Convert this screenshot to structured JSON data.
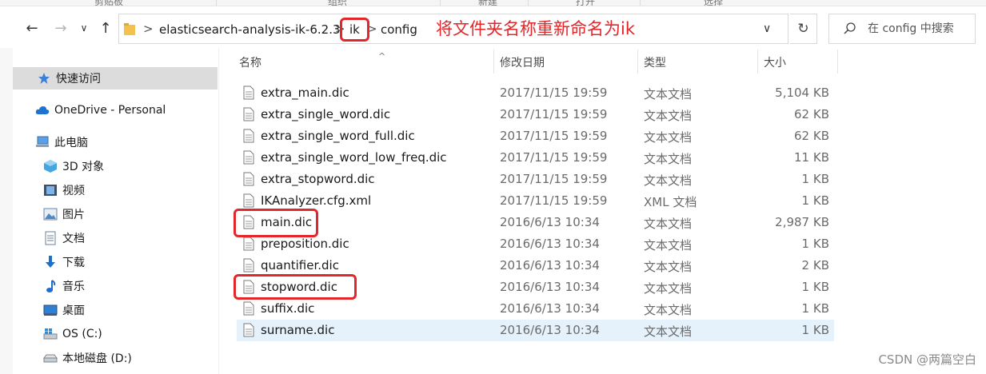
{
  "ribbon": {
    "items": [
      "剪贴板",
      "组织",
      "新建",
      "打开",
      "选择"
    ]
  },
  "nav": {
    "back_glyph": "←",
    "forward_glyph": "→",
    "recent_glyph": "∨",
    "up_glyph": "↑"
  },
  "address": {
    "segments": [
      "elasticsearch-analysis-ik-6.2.3",
      "ik",
      "config"
    ],
    "separator": ">",
    "annotation": "将文件夹名称重新命名为ik",
    "dropdown_glyph": "∨"
  },
  "refresh_glyph": "↻",
  "search": {
    "placeholder": "在 config 中搜索"
  },
  "sidebar": {
    "items": [
      {
        "label": "快速访问",
        "icon": "star-icon"
      },
      {
        "label": "OneDrive - Personal",
        "icon": "cloud-icon"
      },
      {
        "label": "此电脑",
        "icon": "computer-icon"
      },
      {
        "label": "3D 对象",
        "icon": "cube-icon"
      },
      {
        "label": "视频",
        "icon": "video-icon"
      },
      {
        "label": "图片",
        "icon": "picture-icon"
      },
      {
        "label": "文档",
        "icon": "document-icon"
      },
      {
        "label": "下载",
        "icon": "download-icon"
      },
      {
        "label": "音乐",
        "icon": "music-icon"
      },
      {
        "label": "桌面",
        "icon": "desktop-icon"
      },
      {
        "label": "OS (C:)",
        "icon": "windows-drive-icon"
      },
      {
        "label": "本地磁盘 (D:)",
        "icon": "drive-icon"
      }
    ]
  },
  "columns": {
    "name": "名称",
    "modified": "修改日期",
    "type": "类型",
    "size": "大小",
    "sort_glyph": "^"
  },
  "files": [
    {
      "name": "extra_main.dic",
      "modified": "2017/11/15 19:59",
      "type": "文本文档",
      "size": "5,104 KB"
    },
    {
      "name": "extra_single_word.dic",
      "modified": "2017/11/15 19:59",
      "type": "文本文档",
      "size": "62 KB"
    },
    {
      "name": "extra_single_word_full.dic",
      "modified": "2017/11/15 19:59",
      "type": "文本文档",
      "size": "62 KB"
    },
    {
      "name": "extra_single_word_low_freq.dic",
      "modified": "2017/11/15 19:59",
      "type": "文本文档",
      "size": "11 KB"
    },
    {
      "name": "extra_stopword.dic",
      "modified": "2017/11/15 19:59",
      "type": "文本文档",
      "size": "1 KB"
    },
    {
      "name": "IKAnalyzer.cfg.xml",
      "modified": "2017/11/15 19:59",
      "type": "XML 文档",
      "size": "1 KB"
    },
    {
      "name": "main.dic",
      "modified": "2016/6/13 10:34",
      "type": "文本文档",
      "size": "2,987 KB"
    },
    {
      "name": "preposition.dic",
      "modified": "2016/6/13 10:34",
      "type": "文本文档",
      "size": "1 KB"
    },
    {
      "name": "quantifier.dic",
      "modified": "2016/6/13 10:34",
      "type": "文本文档",
      "size": "2 KB"
    },
    {
      "name": "stopword.dic",
      "modified": "2016/6/13 10:34",
      "type": "文本文档",
      "size": "1 KB"
    },
    {
      "name": "suffix.dic",
      "modified": "2016/6/13 10:34",
      "type": "文本文档",
      "size": "1 KB"
    },
    {
      "name": "surname.dic",
      "modified": "2016/6/13 10:34",
      "type": "文本文档",
      "size": "1 KB"
    }
  ],
  "watermark": "CSDN @两篇空白",
  "colors": {
    "annotation": "#e3262a",
    "selected_row": "#e5f1fb",
    "selected_sidebar": "#dcdcdc",
    "accent_blue": "#0a64c8"
  }
}
